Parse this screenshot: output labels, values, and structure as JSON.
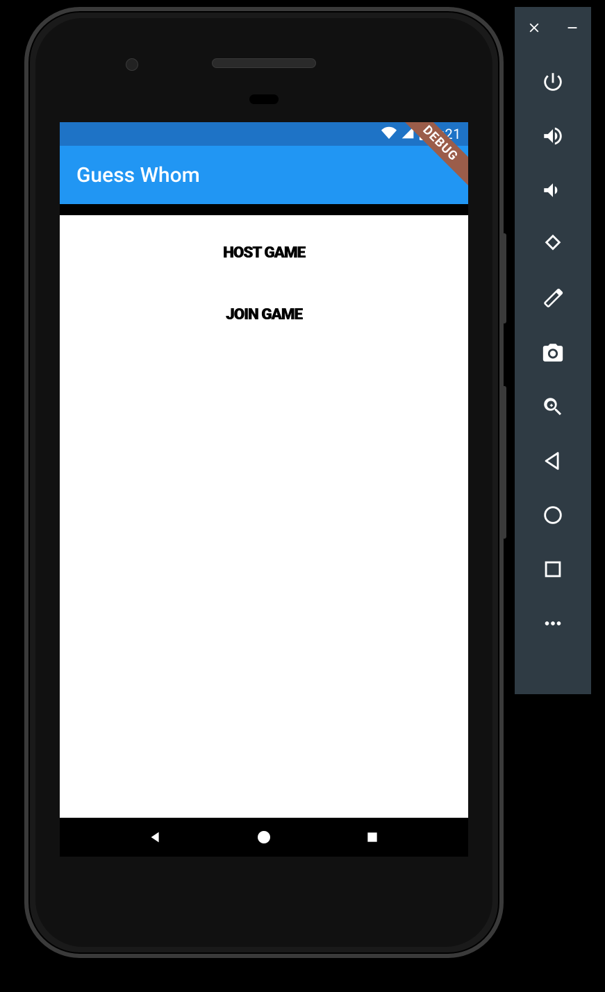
{
  "emulator": {
    "toolbar_icons": [
      "close-icon",
      "minimize-icon",
      "power-icon",
      "volume-up-icon",
      "volume-down-icon",
      "rotate-left-icon",
      "rotate-right-icon",
      "camera-icon",
      "zoom-in-icon",
      "back-icon",
      "home-icon",
      "overview-icon",
      "more-icon"
    ]
  },
  "statusbar": {
    "time": "8:21"
  },
  "appbar": {
    "title": "Guess Whom",
    "debug_label": "DEBUG"
  },
  "menu": {
    "host_label": "HOST GAME",
    "join_label": "JOIN GAME"
  }
}
